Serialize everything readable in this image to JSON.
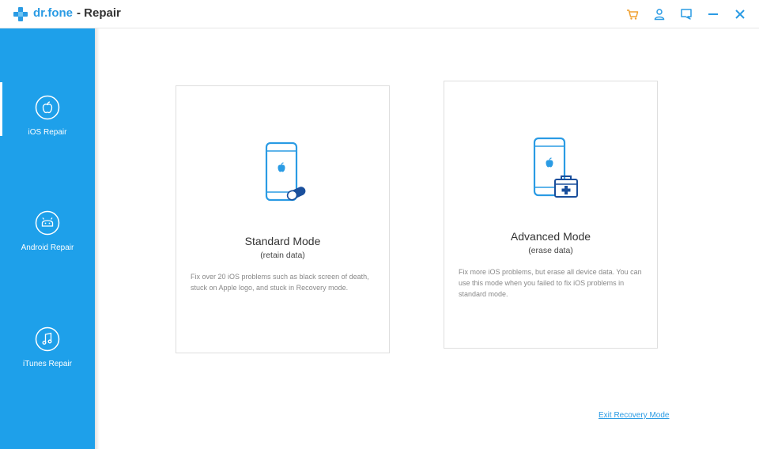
{
  "titlebar": {
    "brand": "dr.fone",
    "title": "- Repair",
    "icons": [
      "cart-icon",
      "account-icon",
      "feedback-icon",
      "minimize-icon",
      "close-icon"
    ]
  },
  "sidebar": {
    "items": [
      {
        "label": "iOS Repair",
        "icon": "apple-icon",
        "active": true
      },
      {
        "label": "Android Repair",
        "icon": "android-icon",
        "active": false
      },
      {
        "label": "iTunes Repair",
        "icon": "music-note-icon",
        "active": false
      }
    ]
  },
  "cards": [
    {
      "title": "Standard Mode",
      "subtitle": "(retain data)",
      "description": "Fix over 20 iOS problems such as black screen of death, stuck on Apple logo, and stuck in Recovery mode.",
      "icon": "phone-pill-icon"
    },
    {
      "title": "Advanced Mode",
      "subtitle": "(erase data)",
      "description": "Fix more iOS problems, but erase all device data. You can use this mode when you failed to fix iOS problems in standard mode.",
      "icon": "phone-medkit-icon"
    }
  ],
  "footer": {
    "exit_link": "Exit Recovery Mode"
  },
  "colors": {
    "accent": "#2a9be4",
    "sidebar": "#1ea0ea",
    "cart": "#f0a030"
  }
}
